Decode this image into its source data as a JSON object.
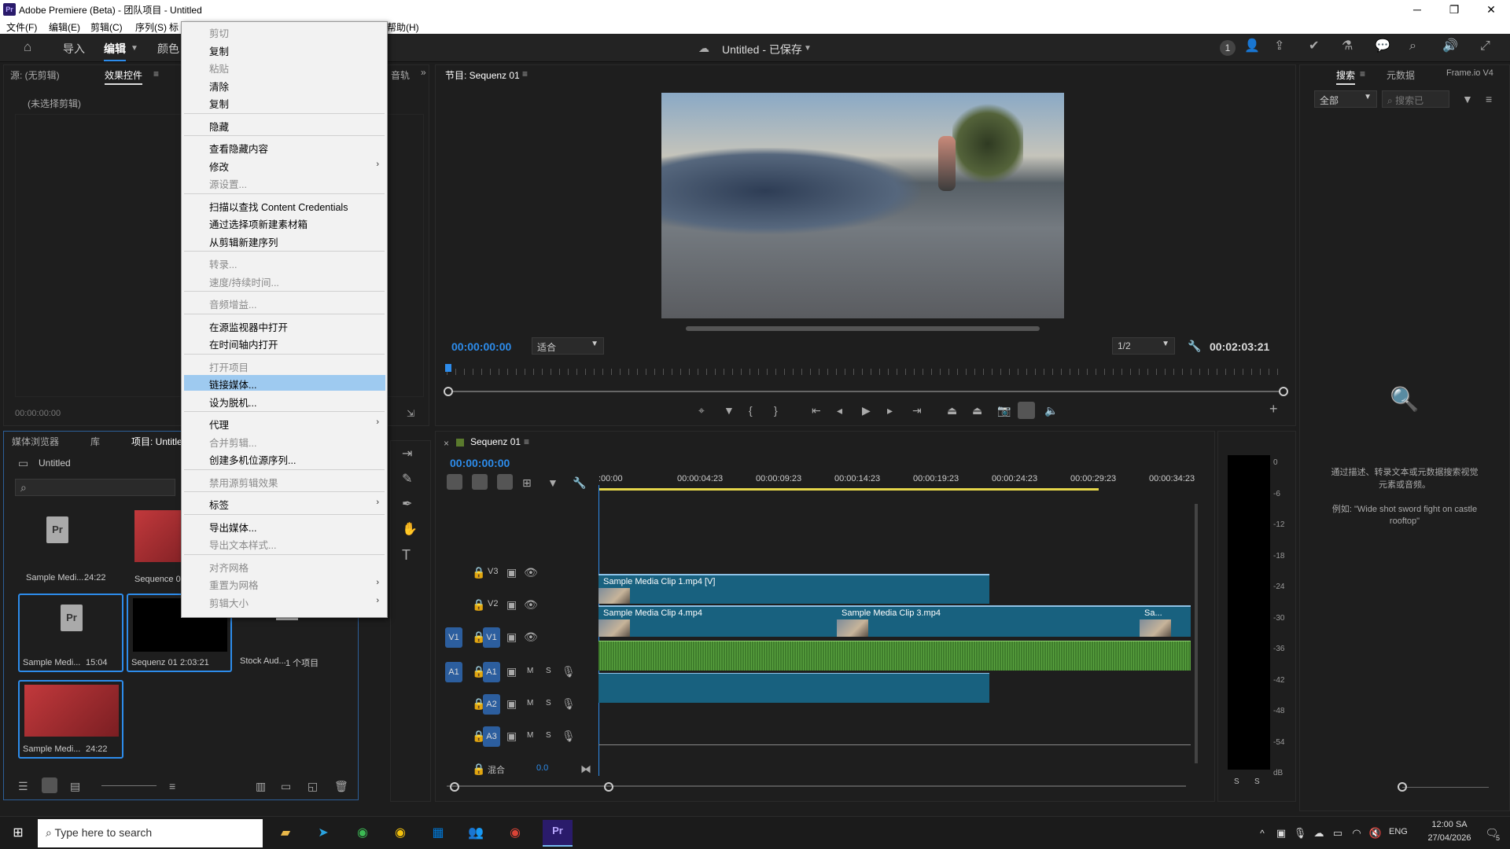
{
  "window": {
    "title": "Adobe Premiere (Beta) - 团队项目 - Untitled",
    "app_icon": "Pr",
    "controls": [
      "─",
      "❐",
      "✕"
    ]
  },
  "menu": [
    "文件(F)",
    "编辑(E)",
    "剪辑(C)",
    "序列(S)",
    "标",
    "帮助(H)"
  ],
  "appbar": {
    "workspaces": [
      "导入",
      "编辑",
      "颜色"
    ],
    "project_title": "Untitled - 已保存",
    "badge": "1"
  },
  "source_panel": {
    "tabs": [
      "源: (无剪辑)",
      "效果控件",
      "音轨"
    ],
    "empty": "(未选择剪辑)",
    "timecode": "00:00:00:00"
  },
  "program": {
    "title": "节目: Sequenz 01",
    "timecode": "00:00:00:00",
    "fit": "适合",
    "quality": "1/2",
    "duration": "00:02:03:21"
  },
  "search_panel": {
    "tabs": [
      "搜索",
      "元数据",
      "Frame.io V4"
    ],
    "filter": "全部",
    "placeholder": "搜索已",
    "hint": "通过描述、转录文本或元数据搜索视觉元素或音频。",
    "example": "例如: \"Wide shot sword fight on castle rooftop\""
  },
  "project_panel": {
    "tabs": [
      "媒体浏览器",
      "库",
      "项目: Untitled"
    ],
    "folder": "Untitled",
    "items": [
      {
        "name": "Sample Medi...",
        "dur": "24:22"
      },
      {
        "name": "Sequence 01",
        "dur": ""
      },
      {
        "name": "Sample Medi...",
        "dur": "15:04"
      },
      {
        "name": "Sequenz 01",
        "dur": "2:03:21"
      },
      {
        "name": "Stock Aud...",
        "dur": "1 个项目"
      },
      {
        "name": "Sample Medi...",
        "dur": "24:22"
      }
    ]
  },
  "context_menu": {
    "items": [
      {
        "label": "剪切",
        "disabled": true
      },
      {
        "label": "复制",
        "disabled": false
      },
      {
        "label": "粘贴",
        "disabled": true
      },
      {
        "label": "清除",
        "disabled": false
      },
      {
        "label": "复制",
        "disabled": false
      },
      {
        "label": "隐藏",
        "disabled": false
      },
      {
        "label": "查看隐藏内容",
        "disabled": false
      },
      {
        "label": "修改",
        "disabled": false,
        "sub": true
      },
      {
        "label": "源设置...",
        "disabled": true
      },
      {
        "label": "扫描以查找 Content Credentials",
        "disabled": false
      },
      {
        "label": "通过选择项新建素材箱",
        "disabled": false
      },
      {
        "label": "从剪辑新建序列",
        "disabled": false
      },
      {
        "label": "转录...",
        "disabled": true
      },
      {
        "label": "速度/持续时间...",
        "disabled": true
      },
      {
        "label": "音频增益...",
        "disabled": true
      },
      {
        "label": "在源监视器中打开",
        "disabled": false
      },
      {
        "label": "在时间轴内打开",
        "disabled": false
      },
      {
        "label": "打开项目",
        "disabled": true
      },
      {
        "label": "链接媒体...",
        "disabled": false,
        "highlighted": true
      },
      {
        "label": "设为脱机...",
        "disabled": false
      },
      {
        "label": "代理",
        "disabled": false,
        "sub": true
      },
      {
        "label": "合并剪辑...",
        "disabled": true
      },
      {
        "label": "创建多机位源序列...",
        "disabled": false
      },
      {
        "label": "禁用源剪辑效果",
        "disabled": true
      },
      {
        "label": "标签",
        "disabled": false,
        "sub": true
      },
      {
        "label": "导出媒体...",
        "disabled": false
      },
      {
        "label": "导出文本样式...",
        "disabled": true
      },
      {
        "label": "对齐网格",
        "disabled": true
      },
      {
        "label": "重置为网格",
        "disabled": true,
        "sub": true
      },
      {
        "label": "剪辑大小",
        "disabled": true,
        "sub": true
      }
    ]
  },
  "timeline": {
    "tab": "Sequenz 01",
    "timecode": "00:00:00:00",
    "ruler": [
      ":00:00",
      "00:00:04:23",
      "00:00:09:23",
      "00:00:14:23",
      "00:00:19:23",
      "00:00:24:23",
      "00:00:29:23",
      "00:00:34:23"
    ],
    "tracks": [
      {
        "name": "V3",
        "src": ""
      },
      {
        "name": "V2",
        "src": ""
      },
      {
        "name": "V1",
        "src": "V1"
      },
      {
        "name": "A1",
        "src": "A1"
      },
      {
        "name": "A2",
        "src": ""
      },
      {
        "name": "A3",
        "src": ""
      }
    ],
    "track_ms": [
      "M",
      "S"
    ],
    "mix_label": "混合",
    "mix_value": "0.0",
    "clips": {
      "v2": "Sample Media Clip 1.mp4 [V]",
      "v1a": "Sample Media Clip 4.mp4",
      "v1b": "Sample Media Clip 3.mp4",
      "v1c": "Sa..."
    }
  },
  "meter": {
    "scale": [
      "0",
      "-6",
      "-12",
      "-18",
      "-24",
      "-30",
      "-36",
      "-42",
      "-48",
      "-54",
      "dB"
    ],
    "ss": [
      "S",
      "S"
    ]
  },
  "taskbar": {
    "search": "Type here to search",
    "time": "12:00 SA",
    "date": "27/04/2026",
    "lang": "ENG",
    "notif": "5"
  }
}
